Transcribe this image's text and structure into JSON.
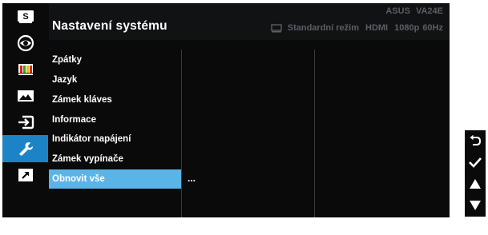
{
  "header": {
    "title": "Nastavení systému",
    "model": "ASUS  VA24E",
    "status": {
      "mode": "Standardní režim",
      "input": "HDMI",
      "resolution": "1080p",
      "refresh": "60Hz"
    }
  },
  "sidebar": {
    "items": [
      {
        "name": "splendid",
        "icon": "s-letter-icon"
      },
      {
        "name": "eye-care",
        "icon": "eye-icon"
      },
      {
        "name": "color",
        "icon": "color-bars-icon"
      },
      {
        "name": "image",
        "icon": "picture-icon"
      },
      {
        "name": "input-select",
        "icon": "input-icon"
      },
      {
        "name": "system-setup",
        "icon": "wrench-icon",
        "active": true
      },
      {
        "name": "shortcut",
        "icon": "arrow-icon"
      }
    ],
    "s_letter": "S"
  },
  "menu": {
    "items": [
      {
        "label": "Zpátky"
      },
      {
        "label": "Jazyk"
      },
      {
        "label": "Zámek kláves"
      },
      {
        "label": "Informace"
      },
      {
        "label": "Indikátor napájení"
      },
      {
        "label": "Zámek vypínače"
      },
      {
        "label": "Obnovit vše",
        "selected": true
      }
    ],
    "submenu_value": "..."
  },
  "navkeys": [
    "back-icon",
    "check-icon",
    "up-arrow-icon",
    "down-arrow-icon"
  ],
  "colors": {
    "active_icon_bg": "#1c84c6",
    "selected_item_bg": "#5ab4e6",
    "panel_bg": "#0a0a0a",
    "header_text_dim": "#5b5e63"
  }
}
